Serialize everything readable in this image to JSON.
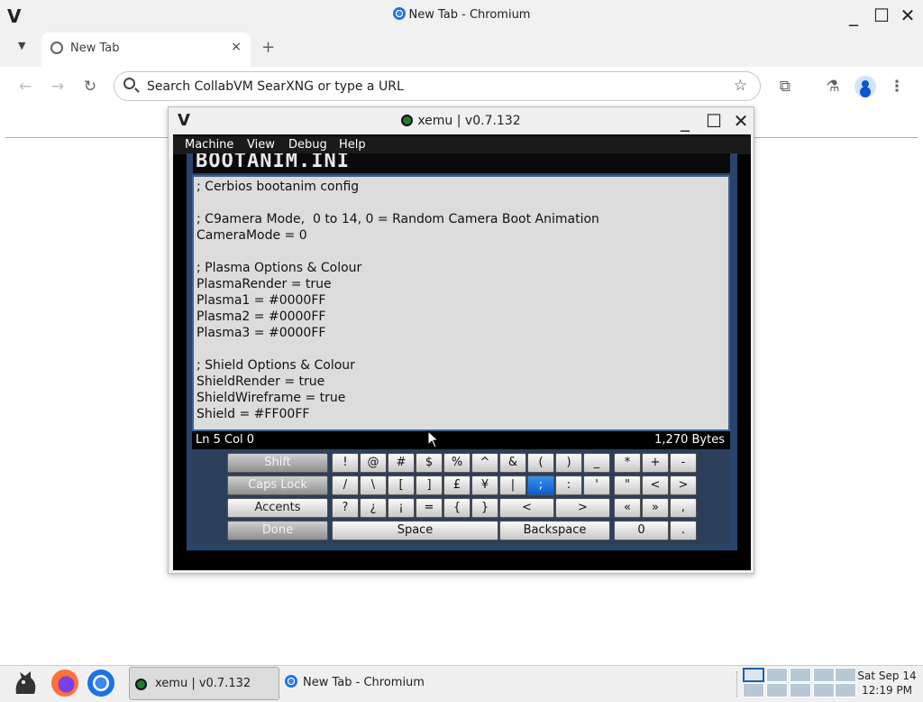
{
  "os_window": {
    "title": "New Tab - Chromium",
    "wm_logo": "V"
  },
  "browser": {
    "tab": {
      "label": "New Tab",
      "close": "×"
    },
    "new_tab": "+",
    "omnibox": {
      "placeholder": "Search CollabVM SearXNG or type a URL"
    },
    "toolbar_icons": [
      "back-icon",
      "forward-icon",
      "reload-icon",
      "bookmark-star-icon",
      "extensions-icon",
      "labs-icon",
      "profile-icon",
      "menu-icon"
    ]
  },
  "xemu": {
    "title": "xemu | v0.7.132",
    "logo": "V",
    "menu": [
      "Machine",
      "View",
      "Debug",
      "Help"
    ],
    "screen": {
      "header": "BOOTANIM.INI",
      "lines": [
        "; Cerbios bootanim config",
        "",
        "; C9amera Mode,  0 to 14, 0 = Random Camera Boot Animation",
        "CameraMode = 0",
        "",
        "; Plasma Options & Colour",
        "PlasmaRender = true",
        "Plasma1 = #0000FF",
        "Plasma2 = #0000FF",
        "Plasma3 = #0000FF",
        "",
        "; Shield Options & Colour",
        "ShieldRender = true",
        "ShieldWireframe = true",
        "Shield = #FF00FF"
      ],
      "status": {
        "position": "Ln 5  Col 0",
        "size": "1,270 Bytes"
      },
      "keyboard": {
        "left": [
          "Shift",
          "Caps Lock",
          "Accents",
          "Done"
        ],
        "row1": [
          "!",
          "@",
          "#",
          "$",
          "%",
          "^",
          "&",
          "(",
          ")",
          "_"
        ],
        "row2": [
          "/",
          "\\",
          "[",
          "]",
          "£",
          "¥",
          "|",
          ";",
          ":",
          "'"
        ],
        "row3": [
          "?",
          "¿",
          "¡",
          "=",
          "{",
          "}",
          "<",
          ">"
        ],
        "right1": [
          "*",
          "+",
          "-"
        ],
        "right2": [
          "\"",
          "<",
          ">"
        ],
        "right3": [
          "«",
          "»",
          ","
        ],
        "space": "Space",
        "backspace": "Backspace",
        "zero": "0",
        "dot": ".",
        "selected": ";"
      }
    }
  },
  "taskbar": {
    "items": [
      {
        "label": "xemu | v0.7.132"
      },
      {
        "label": "New Tab - Chromium"
      }
    ],
    "clock": {
      "date": "Sat Sep 14",
      "time": "12:19 PM"
    }
  }
}
